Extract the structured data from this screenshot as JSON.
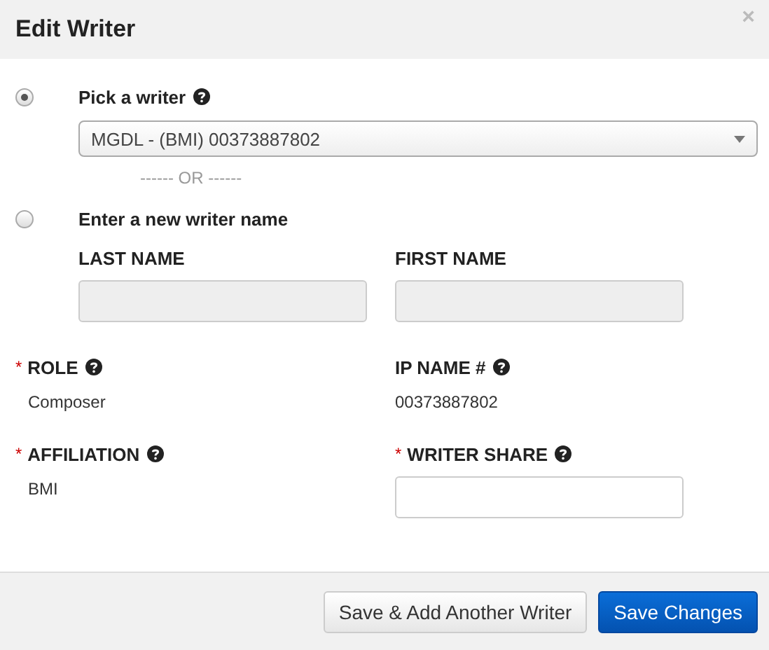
{
  "dialog": {
    "title": "Edit Writer",
    "close": "×"
  },
  "required_mark": "*",
  "options": [
    {
      "label": "Pick a writer",
      "selected": true,
      "help": true
    },
    {
      "label": "Enter a new writer name",
      "selected": false,
      "help": false
    }
  ],
  "writer_select": {
    "value": "MGDL - (BMI) 00373887802"
  },
  "separator": "------ OR ------",
  "name_fields": [
    {
      "label": "LAST NAME",
      "disabled": true
    },
    {
      "label": "FIRST NAME",
      "disabled": true
    }
  ],
  "details": [
    {
      "label": "ROLE",
      "required": true,
      "help": true,
      "kind": "text",
      "value": "Composer"
    },
    {
      "label": "IP NAME #",
      "required": false,
      "help": true,
      "kind": "text",
      "value": "00373887802"
    },
    {
      "label": "AFFILIATION",
      "required": true,
      "help": true,
      "kind": "text",
      "value": "BMI"
    },
    {
      "label": "WRITER SHARE",
      "required": true,
      "help": true,
      "kind": "input"
    }
  ],
  "buttons": [
    {
      "label": "Save & Add Another Writer",
      "kind": "default"
    },
    {
      "label": "Save Changes",
      "kind": "primary"
    }
  ]
}
